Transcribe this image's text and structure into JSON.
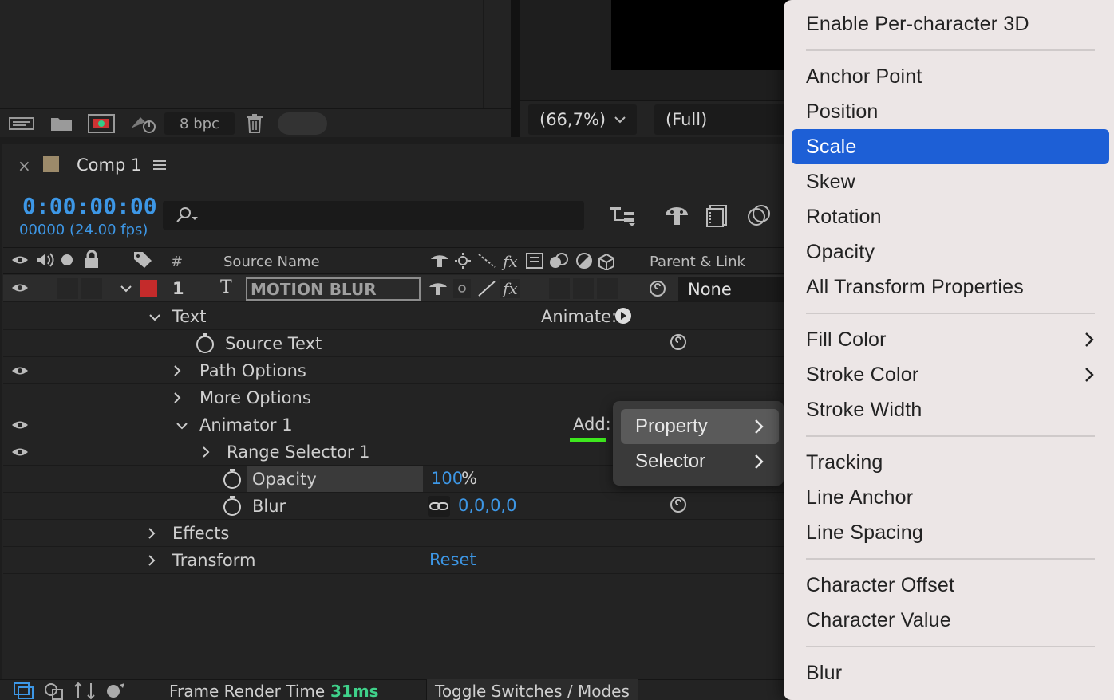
{
  "project_panel": {
    "bpc_label": "8 bpc"
  },
  "viewer": {
    "zoom": "(66,7%)",
    "resolution": "(Full)"
  },
  "comp": {
    "close": "×",
    "name": "Comp 1",
    "timecode": "0:00:00:00",
    "frame_info": "00000 (24.00 fps)"
  },
  "columns": {
    "number": "#",
    "source_name": "Source Name",
    "parent_link": "Parent & Link"
  },
  "layer": {
    "index": "1",
    "type_glyph": "T",
    "name": "MOTION BLUR",
    "parent": "None",
    "label_color": "#c42b2b"
  },
  "tree": {
    "text": "Text",
    "animate_label": "Animate:",
    "source_text": "Source Text",
    "path_options": "Path Options",
    "more_options": "More Options",
    "animator": "Animator 1",
    "add_label": "Add:",
    "range_selector": "Range Selector 1",
    "opacity_label": "Opacity",
    "opacity_value": "100",
    "opacity_unit": "%",
    "blur_label": "Blur",
    "blur_value": "0,0,0,0",
    "effects": "Effects",
    "transform": "Transform",
    "transform_reset": "Reset"
  },
  "add_submenu": {
    "items": [
      "Property",
      "Selector"
    ],
    "highlighted": "Property"
  },
  "property_menu": {
    "selected": "Scale",
    "items": [
      "Enable Per-character 3D",
      "Anchor Point",
      "Position",
      "Scale",
      "Skew",
      "Rotation",
      "Opacity",
      "All Transform Properties",
      "Fill Color",
      "Stroke Color",
      "Stroke Width",
      "Tracking",
      "Line Anchor",
      "Line Spacing",
      "Character Offset",
      "Character Value",
      "Blur"
    ]
  },
  "status": {
    "render_label": "Frame Render Time",
    "render_value": "31ms",
    "toggle_label": "Toggle Switches / Modes"
  },
  "colors": {
    "accent_blue": "#3d97e6",
    "menu_selection": "#1d5fd6",
    "render_time": "#3fd18a",
    "add_underline": "#3ee81e"
  }
}
